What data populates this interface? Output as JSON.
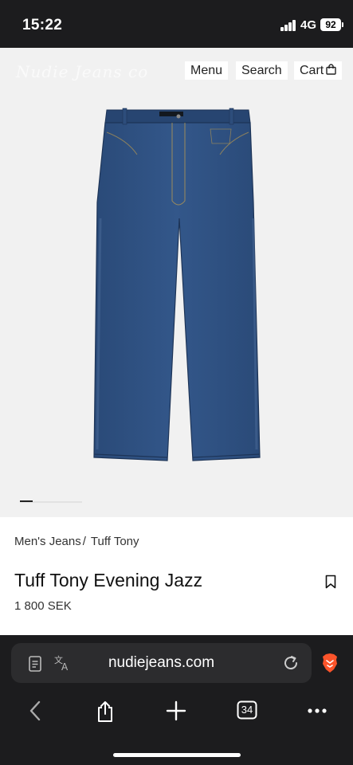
{
  "status_bar": {
    "time": "15:22",
    "network": "4G",
    "battery": "92"
  },
  "header": {
    "logo_text": "Nudie Jeans co",
    "menu_label": "Menu",
    "search_label": "Search",
    "cart_label": "Cart"
  },
  "product": {
    "breadcrumb": [
      "Men's Jeans",
      "Tuff Tony"
    ],
    "breadcrumb_separator": "/",
    "title": "Tuff Tony Evening Jazz",
    "price": "1 800 SEK",
    "image_icon": "jeans-image",
    "gallery_count": 5,
    "gallery_active_index": 0
  },
  "browser": {
    "url": "nudiejeans.com",
    "tab_count": "34",
    "icons": [
      "reader-icon",
      "translate-icon",
      "reload-icon",
      "brave-icon",
      "back-icon",
      "share-icon",
      "new-tab-icon",
      "tabs-icon",
      "more-icon"
    ]
  },
  "colors": {
    "denim": "#2e4f7f",
    "hero_bg": "#f1f1f1",
    "chrome_bg": "#1c1c1e"
  }
}
